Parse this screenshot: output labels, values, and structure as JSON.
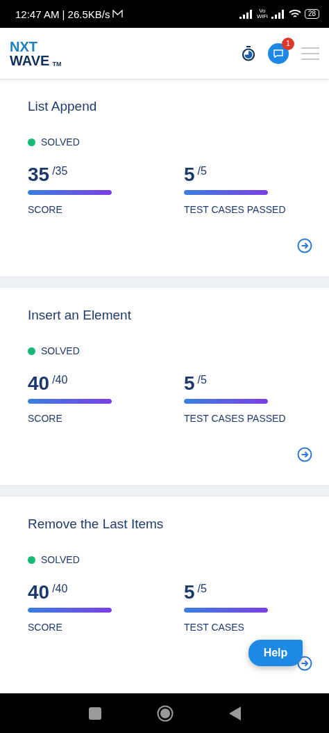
{
  "status_bar": {
    "time_speed": "12:47 AM | 26.5KB/s",
    "vowifi_top": "Vo",
    "vowifi_bottom": "WiFi",
    "battery": "28"
  },
  "header": {
    "logo_top": "NXT",
    "logo_bottom": "WAVE",
    "logo_tm": "TM",
    "chat_badge": "1"
  },
  "cards": [
    {
      "title": "List Append",
      "status": "SOLVED",
      "color": "#16b877",
      "metrics": [
        {
          "value": "35",
          "total": "/35",
          "level": 1,
          "label": "SCORE"
        },
        {
          "value": "5",
          "total": "/5",
          "level": 1,
          "label": "TEST CASES PASSED"
        }
      ]
    },
    {
      "title": "Insert an Element",
      "status": "SOLVED",
      "color": "#16b877",
      "metrics": [
        {
          "value": "40",
          "total": "/40",
          "level": 1,
          "label": "SCORE"
        },
        {
          "value": "5",
          "total": "/5",
          "level": 1,
          "label": "TEST CASES PASSED"
        }
      ]
    },
    {
      "title": "Remove the Last Items",
      "status": "SOLVED",
      "color": "#16b877",
      "metrics": [
        {
          "value": "40",
          "total": "/40",
          "level": 1,
          "label": "SCORE"
        },
        {
          "value": "5",
          "total": "/5",
          "level": 1,
          "label": "TEST CASES"
        }
      ]
    }
  ],
  "help_button": "Help"
}
